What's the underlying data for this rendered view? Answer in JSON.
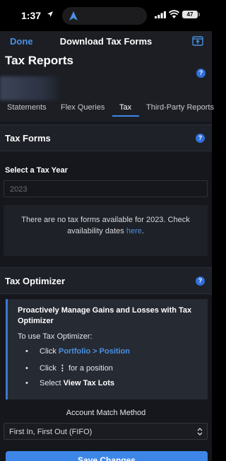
{
  "status_bar": {
    "time": "1:37",
    "battery": "47"
  },
  "nav": {
    "done_label": "Done",
    "title": "Download Tax Forms"
  },
  "header": {
    "title": "Tax Reports",
    "help": "?"
  },
  "tabs": [
    {
      "label": "Statements",
      "active": false
    },
    {
      "label": "Flex Queries",
      "active": false
    },
    {
      "label": "Tax",
      "active": true
    },
    {
      "label": "Third-Party Reports",
      "active": false
    }
  ],
  "tax_forms": {
    "title": "Tax Forms",
    "help": "?",
    "year_label": "Select a Tax Year",
    "year_value": "2023",
    "notice_text": "There are no tax forms available for 2023. Check availability dates ",
    "notice_link": "here",
    "notice_end": "."
  },
  "tax_optimizer": {
    "title": "Tax Optimizer",
    "help": "?",
    "heading": "Proactively Manage Gains and Losses with Tax Optimizer",
    "intro": "To use Tax Optimizer:",
    "step1_prefix": "Click ",
    "step1_link": "Portfolio > Position",
    "step2_prefix": "Click ",
    "step2_icon": "⋮",
    "step2_suffix": " for a position",
    "step3_prefix": "Select ",
    "step3_bold": "View Tax Lots",
    "bullet": "•"
  },
  "match": {
    "label": "Account Match Method",
    "value": "First In, First Out (FIFO)"
  },
  "save_label": "Save Changes",
  "colors": {
    "accent": "#3d86e8",
    "link": "#4a90e2",
    "background": "#15171c"
  }
}
